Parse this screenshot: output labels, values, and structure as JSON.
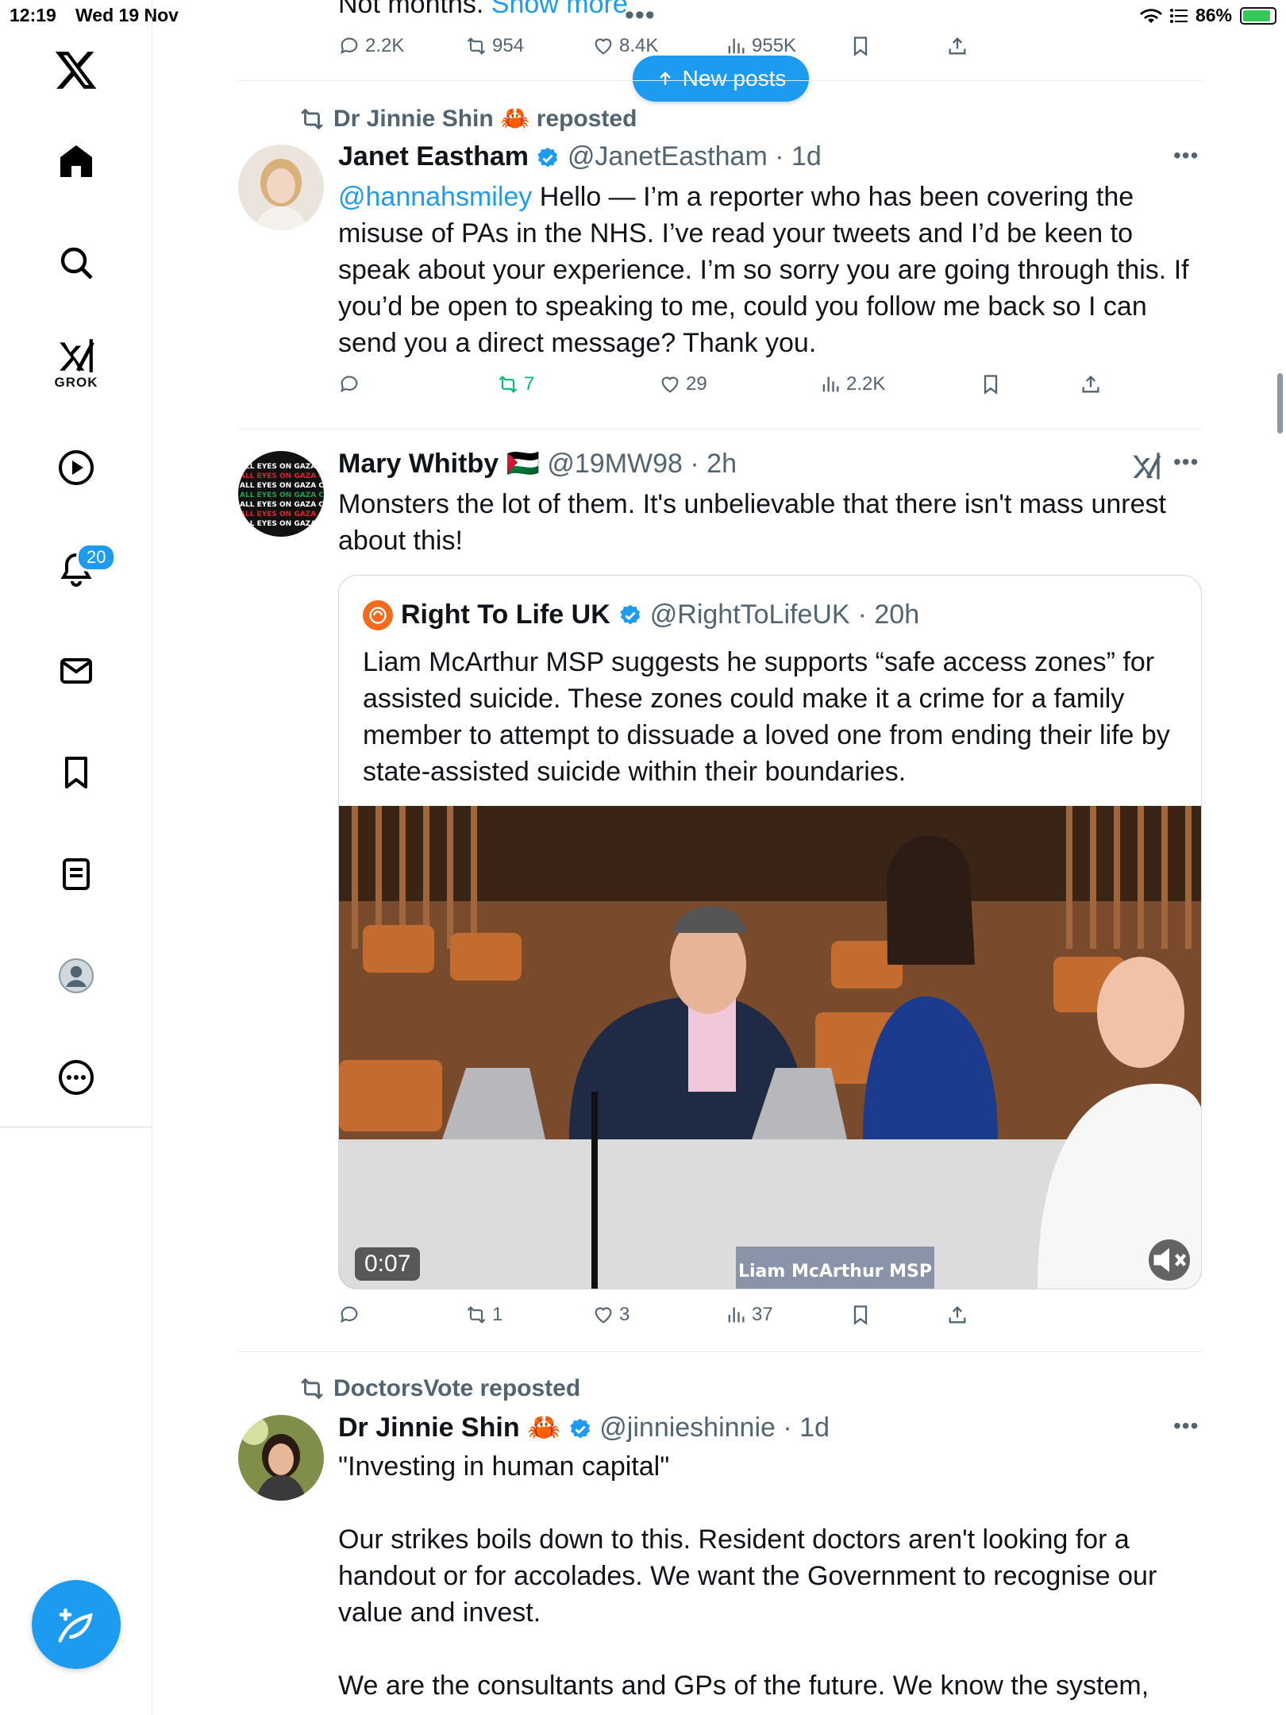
{
  "status_bar": {
    "time": "12:19",
    "date": "Wed 19 Nov",
    "battery": "86%"
  },
  "sidebar": {
    "items": [
      {
        "name": "home"
      },
      {
        "name": "search"
      },
      {
        "name": "grok",
        "label": "GROK"
      },
      {
        "name": "video"
      },
      {
        "name": "notifications",
        "badge": "20"
      },
      {
        "name": "messages"
      },
      {
        "name": "bookmarks"
      },
      {
        "name": "lists"
      },
      {
        "name": "profile"
      },
      {
        "name": "more"
      }
    ]
  },
  "new_posts_label": "New posts",
  "posts": [
    {
      "partial_text": "Not months.",
      "show_more": "Show more",
      "metrics": {
        "replies": "2.2K",
        "reposts": "954",
        "likes": "8.4K",
        "views": "955K"
      }
    },
    {
      "reposted_by": "Dr Jinnie Shin 🦀 reposted",
      "name": "Janet Eastham",
      "handle": "@JanetEastham",
      "time": "· 1d",
      "mention": "@hannahsmiley",
      "text": " Hello — I’m a reporter who has been covering the misuse of PAs in the NHS. I’ve read your tweets and I’d be keen to speak about your experience. I’m so sorry you are going through this. If you’d be open to speaking to me, could you follow me back so I can send you a direct message? Thank you.",
      "metrics": {
        "replies": "",
        "reposts": "7",
        "likes": "29",
        "views": "2.2K"
      }
    },
    {
      "name": "Mary Whitby 🇵🇸",
      "handle": "@19MW98",
      "time": "· 2h",
      "text": "Monsters the lot of them. It's unbelievable that there isn't mass unrest about this!",
      "quote": {
        "name": "Right To Life UK",
        "handle": "@RightToLifeUK",
        "time": "· 20h",
        "text": "Liam McArthur MSP suggests he supports “safe access zones” for assisted suicide. These zones could make it a crime for a family member to attempt to dissuade a loved one from ending their life by state-assisted suicide within their boundaries.",
        "video_time": "0:07",
        "nameplate": "Liam McArthur MSP"
      },
      "metrics": {
        "replies": "",
        "reposts": "1",
        "likes": "3",
        "views": "37"
      }
    },
    {
      "reposted_by": "DoctorsVote reposted",
      "name": "Dr Jinnie Shin 🦀",
      "handle": "@jinnieshinnie",
      "time": "· 1d",
      "para1": "\"Investing in human capital\"",
      "para2": "Our strikes boils down to this. Resident doctors aren't looking for a handout or for accolades. We want the Government to recognise  our value and invest.",
      "para3": "We are the consultants and GPs of the future. We know the system, you"
    }
  ],
  "colors": {
    "accent": "#1d9bf0",
    "muted": "#536471",
    "repost_green": "#00ba7c"
  }
}
